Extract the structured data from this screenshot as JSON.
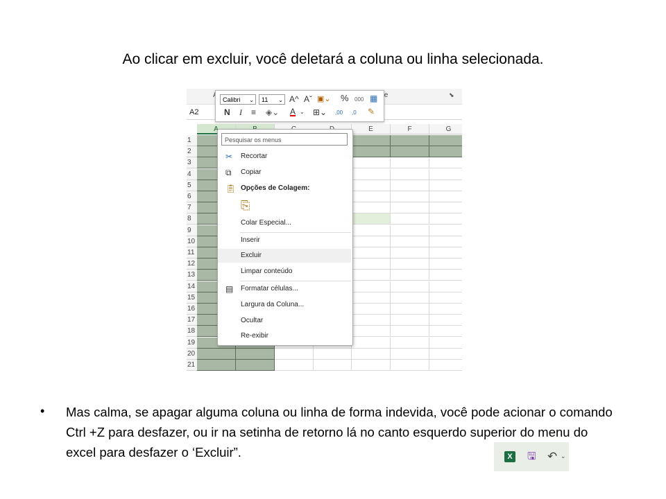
{
  "slide": {
    "title": "Ao clicar em excluir, você deletará a coluna ou linha selecionada.",
    "bullet_symbol": "•",
    "paragraph": "Mas calma, se apagar alguma coluna ou linha de forma indevida, você pode acionar o comando Ctrl +Z para desfazer, ou ir na setinha de retorno lá no canto esquerdo superior do menu do excel para desfazer o ‘Excluir”."
  },
  "excel": {
    "ribbon_fragment_left": "A",
    "ribbon_fragment_right": "te",
    "name_box": "A2",
    "columns": [
      "A",
      "B",
      "C",
      "D",
      "E",
      "F",
      "G"
    ],
    "selected_columns": [
      "A",
      "B"
    ],
    "rows": [
      "1",
      "2",
      "3",
      "4",
      "5",
      "6",
      "7",
      "8",
      "9",
      "10",
      "11",
      "12",
      "13",
      "14",
      "15",
      "16",
      "17",
      "18",
      "19",
      "20",
      "21"
    ]
  },
  "mini_toolbar": {
    "font_name": "Calibri",
    "font_size": "11",
    "grow_font": "A^",
    "shrink_font": "Aˇ",
    "percent": "%",
    "thousands": "000",
    "bold": "N",
    "italic": "I",
    "font_color": "A",
    "dec_increase": ",00",
    "dec_decrease": ",0"
  },
  "context_menu": {
    "search_placeholder": "Pesquisar os menus",
    "items": [
      {
        "label": "Recortar",
        "icon": "scissors-icon"
      },
      {
        "label": "Copiar",
        "icon": "copy-icon"
      },
      {
        "label": "Opções de Colagem:",
        "icon": "paste-icon"
      },
      {
        "label": "Colar Especial...",
        "icon": ""
      },
      {
        "label": "Inserir",
        "icon": ""
      },
      {
        "label": "Excluir",
        "icon": ""
      },
      {
        "label": "Limpar conteúdo",
        "icon": ""
      },
      {
        "label": "Formatar células...",
        "icon": "format-cells-icon"
      },
      {
        "label": "Largura da Coluna...",
        "icon": ""
      },
      {
        "label": "Ocultar",
        "icon": ""
      },
      {
        "label": "Re-exibir",
        "icon": ""
      }
    ],
    "hovered_item": "Excluir"
  },
  "quick_access": {
    "app_icon": "excel-icon",
    "save_icon": "save-icon",
    "undo_icon": "undo-icon",
    "dropdown_icon": "chevron-down-icon"
  },
  "colors": {
    "selection": "#a9b8a5",
    "header_selected": "#d6e7d1",
    "excel_green": "#1d6f42",
    "highlight_cell": "#e2efda",
    "font_color_bar": "#e00000"
  }
}
